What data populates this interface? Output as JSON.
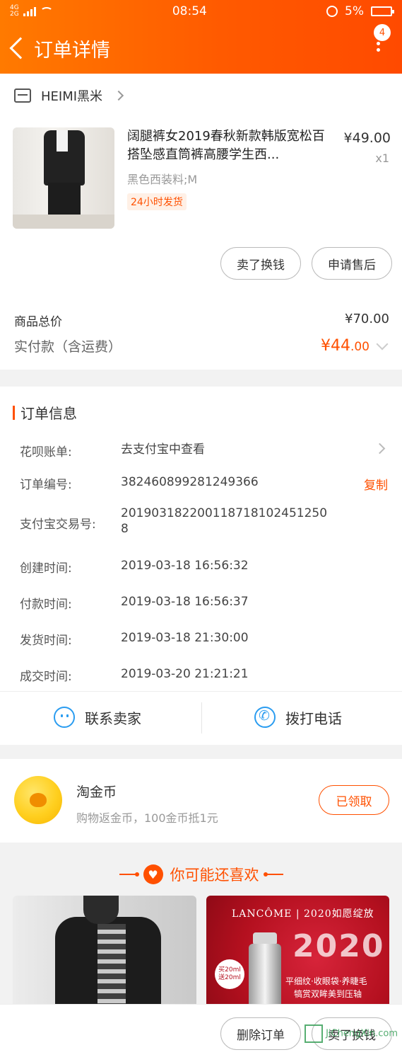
{
  "status_bar": {
    "network_top": "4G",
    "network_bottom": "2G",
    "time": "08:54",
    "battery": "5%"
  },
  "nav": {
    "title": "订单详情",
    "badge_count": "4"
  },
  "shop": {
    "name": "HEIMI黑米"
  },
  "product": {
    "title": "阔腿裤女2019春秋新款韩版宽松百搭坠感直筒裤高腰学生西...",
    "price": "¥49.00",
    "quantity": "x1",
    "sku": "黑色西装料;M",
    "tag": "24小时发货"
  },
  "actions": {
    "sell_label": "卖了换钱",
    "after_sales_label": "申请售后",
    "delete_label": "删除订单",
    "sell_bottom_label": "卖了换钱"
  },
  "summary": {
    "total_label": "商品总价",
    "total_value": "¥70.00",
    "paid_label": "实付款（含运费）",
    "paid_major": "¥44",
    "paid_minor": ".00"
  },
  "order_info": {
    "title": "订单信息",
    "huabei_label": "花呗账单:",
    "huabei_value": "去支付宝中查看",
    "order_no_label": "订单编号:",
    "order_no_value": "382460899281249366",
    "copy_label": "复制",
    "alipay_label": "支付宝交易号:",
    "alipay_value_line1": "201903182200118718102451250",
    "alipay_value_line2": "8",
    "created_label": "创建时间:",
    "created_value": "2019-03-18 16:56:32",
    "paid_label": "付款时间:",
    "paid_value": "2019-03-18 16:56:37",
    "shipped_label": "发货时间:",
    "shipped_value": "2019-03-18 21:30:00",
    "closed_label": "成交时间:",
    "closed_value": "2019-03-20 21:21:21",
    "contact_seller": "联系卖家",
    "call_phone": "拨打电话"
  },
  "coins": {
    "title": "淘金币",
    "subtitle": "购物返金币，100金币抵1元",
    "button": "已领取"
  },
  "recommend": {
    "title": "你可能还喜欢",
    "ad_brand": "LANCÔME | 2020如愿绽放",
    "ad_big": "2020",
    "ad_tag": "买20ml 送20ml",
    "ad_copy1": "平细纹·收眼袋·养睫毛",
    "ad_copy2": "犒赏双眸美到压轴"
  },
  "watermark": "JiChengXin.com",
  "colors": {
    "brand_orange": "#ff5000",
    "link_blue": "#2a9cf0"
  }
}
